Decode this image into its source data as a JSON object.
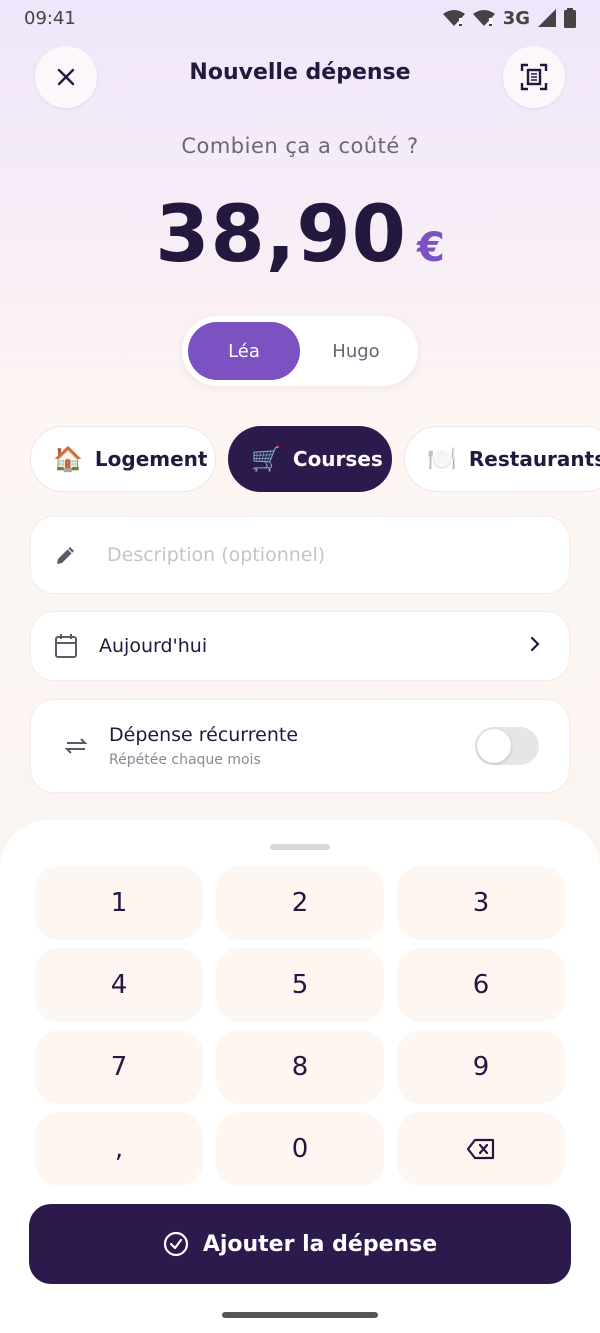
{
  "status_bar": {
    "time": "09:41",
    "network": "3G"
  },
  "header": {
    "title": "Nouvelle dépense",
    "close_icon": "close-icon",
    "scan_icon": "receipt-scan-icon"
  },
  "amount": {
    "question": "Combien ça a coûté ?",
    "value": "38,90",
    "currency": "€"
  },
  "payers": [
    {
      "label": "Léa",
      "selected": true
    },
    {
      "label": "Hugo",
      "selected": false
    }
  ],
  "categories": [
    {
      "emoji": "🏠",
      "label": "Logement",
      "selected": false
    },
    {
      "emoji": "🛒",
      "label": "Courses",
      "selected": true
    },
    {
      "emoji": "🍽️",
      "label": "Restaurants",
      "selected": false
    }
  ],
  "description": {
    "placeholder": "Description (optionnel)",
    "value": ""
  },
  "date": {
    "label": "Aujourd'hui"
  },
  "recurring": {
    "title": "Dépense récurrente",
    "subtitle": "Répétée chaque mois",
    "enabled": false
  },
  "keypad": {
    "keys": [
      "1",
      "2",
      "3",
      "4",
      "5",
      "6",
      "7",
      "8",
      "9",
      ",",
      "0"
    ],
    "backspace_icon": "backspace-icon"
  },
  "submit": {
    "label": "Ajouter la dépense"
  },
  "colors": {
    "accent": "#7c52c3",
    "dark": "#2c1a4d",
    "key_bg": "#fdf6f1"
  }
}
